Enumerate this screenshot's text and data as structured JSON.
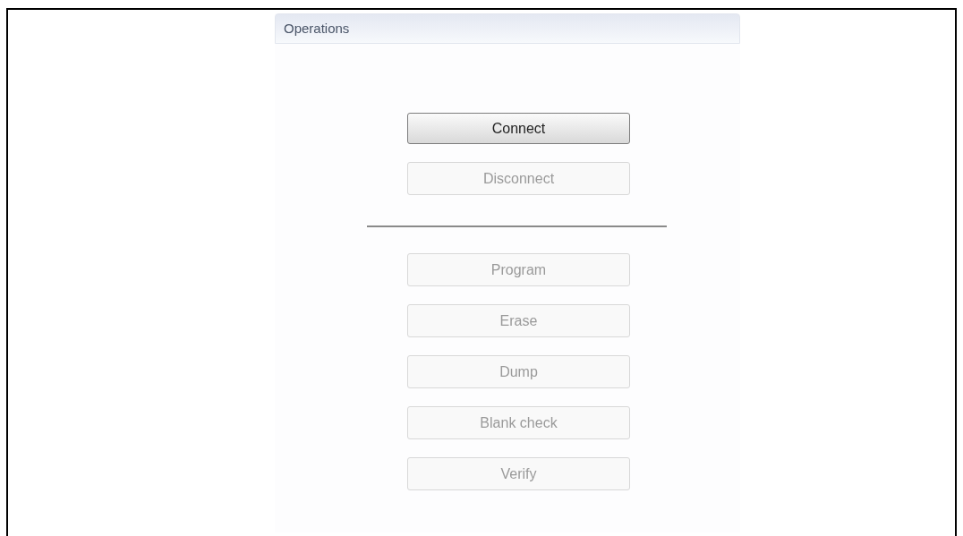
{
  "panel": {
    "title": "Operations"
  },
  "items": [
    {
      "kind": "button",
      "label": "Connect",
      "disabled": false
    },
    {
      "kind": "button",
      "label": "Disconnect",
      "disabled": true
    },
    {
      "kind": "separator"
    },
    {
      "kind": "button",
      "label": "Program",
      "disabled": true
    },
    {
      "kind": "button",
      "label": "Erase",
      "disabled": true
    },
    {
      "kind": "button",
      "label": "Dump",
      "disabled": true
    },
    {
      "kind": "button",
      "label": "Blank check",
      "disabled": true
    },
    {
      "kind": "button",
      "label": "Verify",
      "disabled": true
    }
  ]
}
